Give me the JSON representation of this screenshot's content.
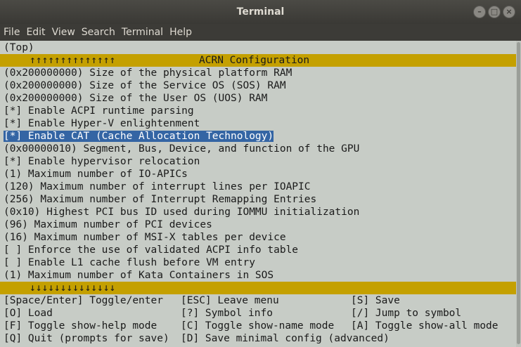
{
  "window": {
    "title": "Terminal",
    "buttons": [
      "–",
      "□",
      "×"
    ]
  },
  "menubar": {
    "items": [
      "File",
      "Edit",
      "View",
      "Search",
      "Terminal",
      "Help"
    ]
  },
  "terminal": {
    "top_label": "(Top)",
    "up_arrows": "↑↑↑↑↑↑↑↑↑↑↑↑↑↑",
    "config_title": "ACRN Configuration",
    "lines": [
      "(0x200000000) Size of the physical platform RAM",
      "(0x200000000) Size of the Service OS (SOS) RAM",
      "(0x200000000) Size of the User OS (UOS) RAM",
      "[*] Enable ACPI runtime parsing",
      "[*] Enable Hyper-V enlightenment",
      "[*] Enable CAT (Cache Allocation Technology)",
      "(0x00000010) Segment, Bus, Device, and function of the GPU",
      "[*] Enable hypervisor relocation",
      "(1) Maximum number of IO-APICs",
      "(120) Maximum number of interrupt lines per IOAPIC",
      "(256) Maximum number of Interrupt Remapping Entries",
      "(0x10) Highest PCI bus ID used during IOMMU initialization",
      "(96) Maximum number of PCI devices",
      "(16) Maximum number of MSI-X tables per device",
      "[ ] Enforce the use of validated ACPI info table",
      "[ ] Enable L1 cache flush before VM entry",
      "(1) Maximum number of Kata Containers in SOS"
    ],
    "selected_index": 5,
    "down_arrows": "↓↓↓↓↓↓↓↓↓↓↓↓↓↓",
    "help": [
      [
        "[Space/Enter] Toggle/enter",
        "[ESC] Leave menu",
        "[S] Save"
      ],
      [
        "[O] Load",
        "[?] Symbol info",
        "[/] Jump to symbol"
      ],
      [
        "[F] Toggle show-help mode",
        "[C] Toggle show-name mode",
        "[A] Toggle show-all mode"
      ],
      [
        "[Q] Quit (prompts for save)",
        "[D] Save minimal config (advanced)",
        ""
      ]
    ]
  },
  "colors": {
    "terminal_bg": "#c7ccc6",
    "bar": "#c4a000",
    "selection": "#3465a4"
  }
}
